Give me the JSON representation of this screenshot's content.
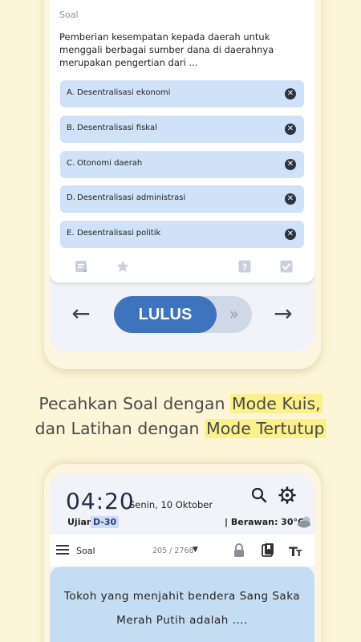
{
  "top": {
    "soal_label": "Soal",
    "question": "Pemberian kesempatan kepada daerah untuk menggali berbagai sumber dana di daerahnya merupakan pengertian dari ...",
    "options": [
      {
        "letter": "A.",
        "text": "Desentralisasi ekonomi"
      },
      {
        "letter": "B.",
        "text": "Desentralisasi fiskal"
      },
      {
        "letter": "C.",
        "text": "Otonomi daerah"
      },
      {
        "letter": "D.",
        "text": "Desentralisasi administrasi"
      },
      {
        "letter": "E.",
        "text": "Desentralisasi politik"
      }
    ],
    "remove_glyph": "✕",
    "toggle_label": "LULUS",
    "toggle_chevron": "»",
    "prev_arrow": "←",
    "next_arrow": "→",
    "icons": [
      "note-icon",
      "star-icon",
      "help-icon",
      "checkbox-icon"
    ]
  },
  "caption": {
    "line1_prefix": "Pecahkan Soal dengan ",
    "line1_highlight": "Mode Kuis,",
    "line2_prefix": "dan Latihan dengan ",
    "line2_highlight": "Mode Tertutup"
  },
  "bottom": {
    "clock": "04:20",
    "date": "Senin, 10 Oktober",
    "ujian_label": "Ujian",
    "dday": "D-30",
    "weather": "| Berawan: 30°C",
    "toolbar_label": "Soal",
    "counter": "205 / 2768",
    "caret": "▼",
    "question": "Tokoh yang menjahit bendera Sang Saka Merah Putih adalah ....",
    "icons": [
      "search-icon",
      "settings-icon",
      "lock-icon",
      "bookmark-icon",
      "text-size-icon",
      "menu-icon",
      "cloud-icon"
    ]
  },
  "colors": {
    "background": "#fdf5d8",
    "option_fill": "#cfe2f7",
    "toggle_knob": "#3e74be",
    "highlight": "#fbf18a",
    "question_panel": "#c5ddf3"
  }
}
